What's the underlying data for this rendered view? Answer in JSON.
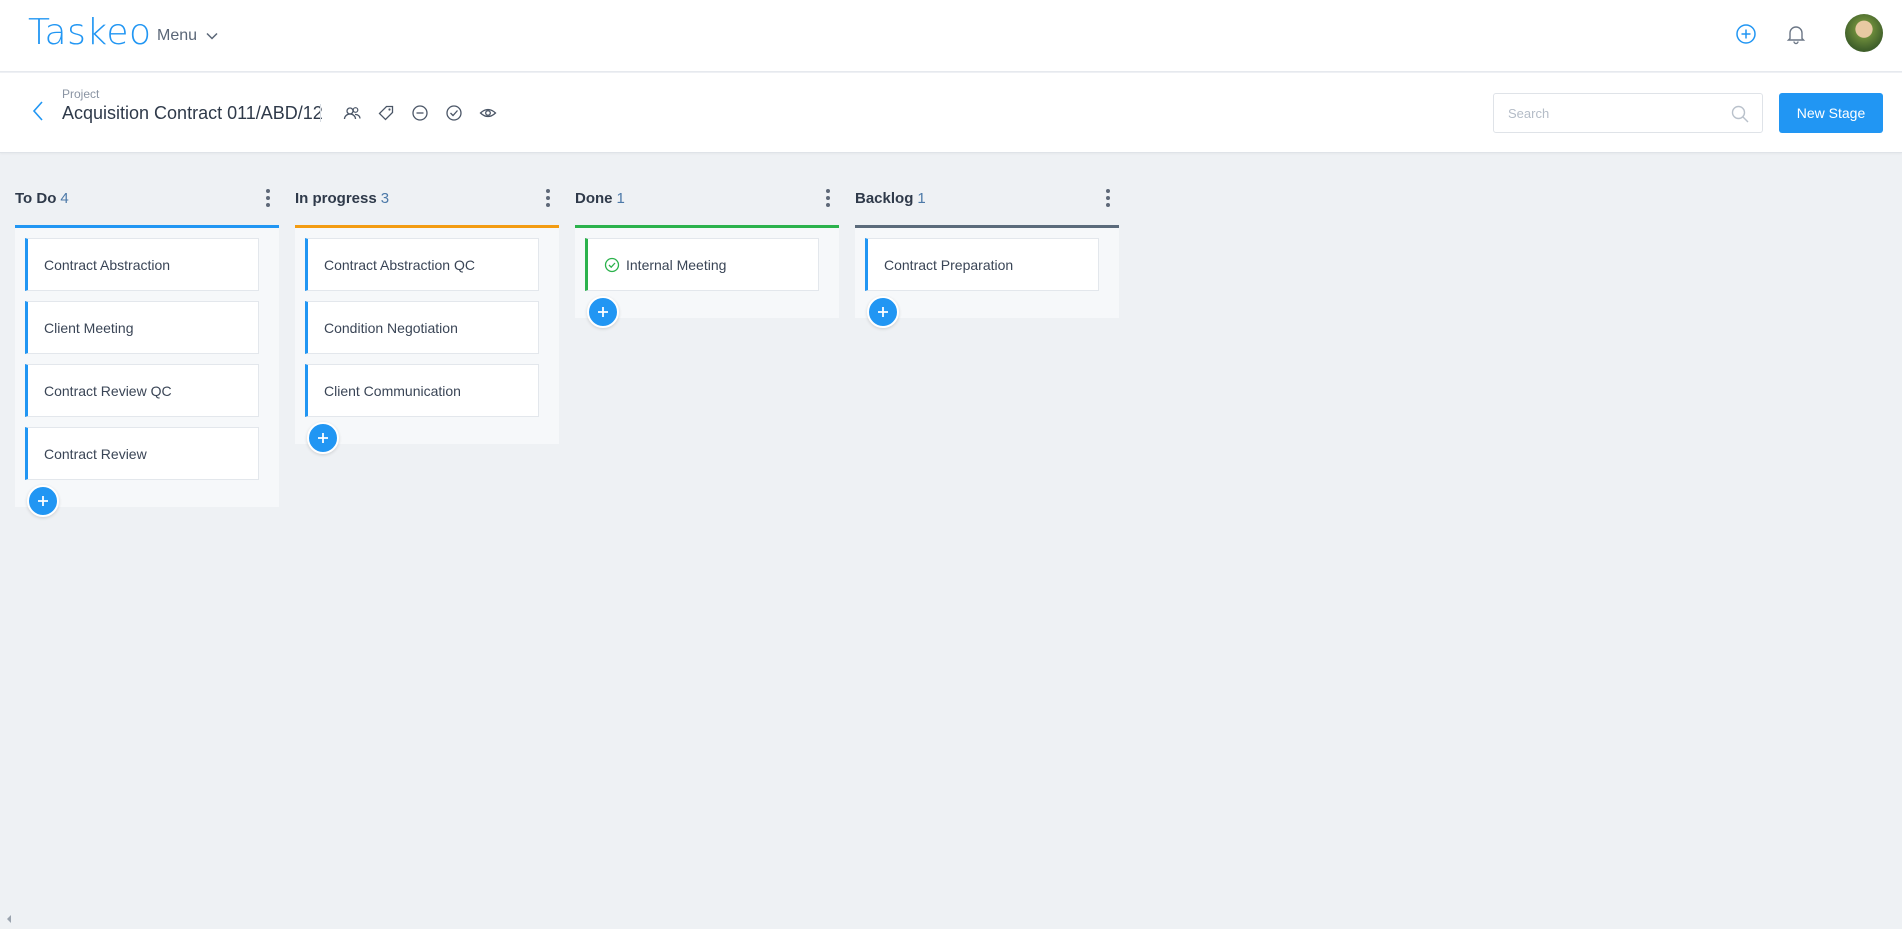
{
  "app": {
    "logo": "Taskeo",
    "menu_label": "Menu"
  },
  "topbar": {
    "icons": [
      "add-circle-icon",
      "bell-icon"
    ],
    "avatar": "user-avatar"
  },
  "project": {
    "label": "Project",
    "title": "Acquisition Contract 011/ABD/12",
    "icons": [
      "users-icon",
      "tag-icon",
      "clock-icon",
      "check-circle-icon",
      "eye-icon"
    ]
  },
  "search": {
    "placeholder": "Search",
    "value": ""
  },
  "new_stage_label": "New Stage",
  "colors": {
    "todo": "#2196f3",
    "in_progress": "#f39c12",
    "done": "#2bb24c",
    "backlog": "#5b6b7b",
    "accent": "#2196f3"
  },
  "columns": [
    {
      "title": "To Do",
      "count": "4",
      "color": "#2196f3",
      "cards": [
        {
          "label": "Contract Abstraction",
          "done": false,
          "color": "#2196f3"
        },
        {
          "label": "Client Meeting",
          "done": false,
          "color": "#2196f3"
        },
        {
          "label": "Contract Review QC",
          "done": false,
          "color": "#2196f3"
        },
        {
          "label": "Contract Review",
          "done": false,
          "color": "#2196f3"
        }
      ]
    },
    {
      "title": "In progress",
      "count": "3",
      "color": "#f39c12",
      "cards": [
        {
          "label": "Contract Abstraction QC",
          "done": false,
          "color": "#2196f3"
        },
        {
          "label": "Condition Negotiation",
          "done": false,
          "color": "#2196f3"
        },
        {
          "label": "Client Communication",
          "done": false,
          "color": "#2196f3"
        }
      ]
    },
    {
      "title": "Done",
      "count": "1",
      "color": "#2bb24c",
      "cards": [
        {
          "label": "Internal Meeting",
          "done": true,
          "color": "#2bb24c"
        }
      ]
    },
    {
      "title": "Backlog",
      "count": "1",
      "color": "#5b6b7b",
      "cards": [
        {
          "label": "Contract Preparation",
          "done": false,
          "color": "#2196f3"
        }
      ]
    }
  ]
}
